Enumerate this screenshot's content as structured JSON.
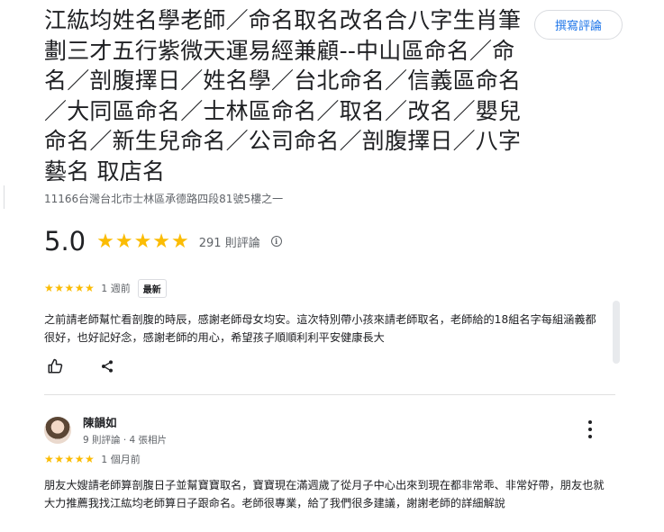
{
  "business": {
    "name": "江紘均姓名學老師／命名取名改名合八字生肖筆劃三才五行紫微天運易經兼顧--中山區命名／命名／剖腹擇日／姓名學／台北命名／信義區命名／大同區命名／士林區命名／取名／改名／嬰兒命名／新生兒命名／公司命名／剖腹擇日／八字 藝名 取店名",
    "address": "11166台灣台北市士林區承德路四段81號5樓之一",
    "rating": "5.0",
    "stars": "★★★★★",
    "review_count": "291 則評論",
    "info_icon": "ⓘ"
  },
  "toolbar": {
    "write_review_label": "撰寫評論"
  },
  "reviews": [
    {
      "stars": "★★★★★",
      "when": "1 週前",
      "badge": "最新",
      "text": "之前請老師幫忙看剖腹的時辰，感謝老師母女均安。這次特別帶小孩來請老師取名，老師給的18組名字每組涵義都很好，也好記好念，感謝老師的用心，希望孩子順順利利平安健康長大",
      "actions": {
        "like_icon": "thumb-up-icon",
        "share_icon": "share-icon"
      }
    },
    {
      "reviewer": "陳韻如",
      "reviewer_meta": "9 則評論 · 4 張相片",
      "stars": "★★★★★",
      "when": "1 個月前",
      "text": "朋友大嫂請老師算剖腹日子並幫寶寶取名，寶寶現在滿週歲了從月子中心出來到現在都非常乖、非常好帶，朋友也就大力推薦我找江紘均老師算日子跟命名。老師很專業，給了我們很多建議，謝謝老師的詳細解說"
    }
  ],
  "colors": {
    "star": "#fbbc04",
    "link": "#1a73e8",
    "muted": "#5f6368"
  }
}
